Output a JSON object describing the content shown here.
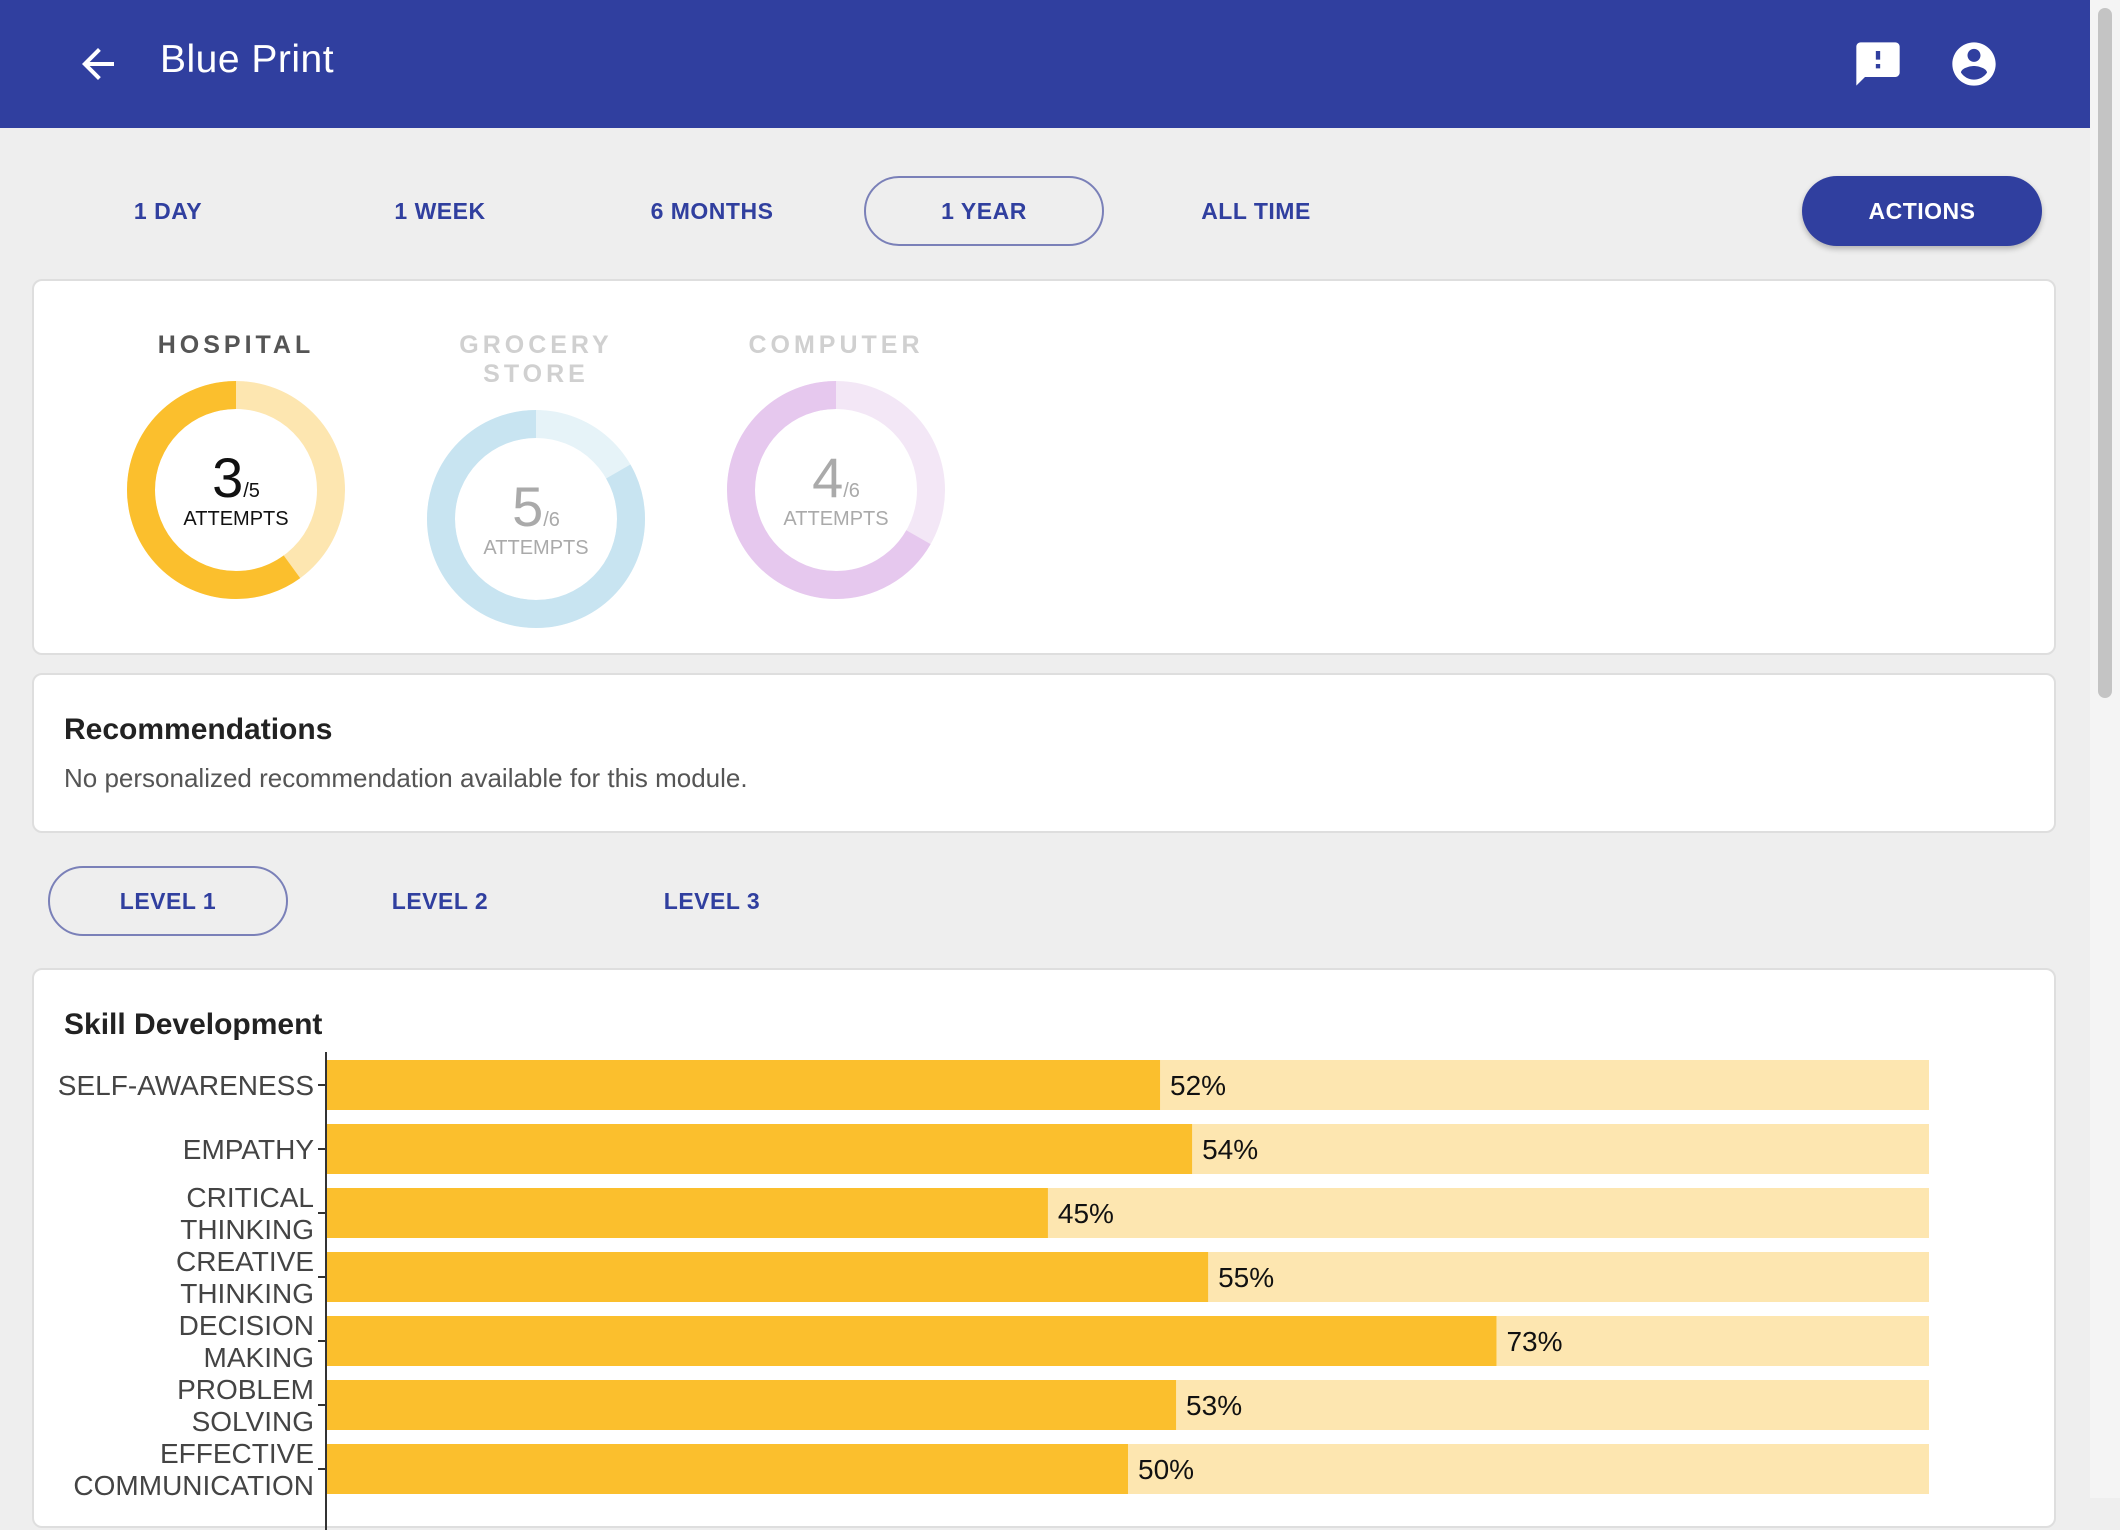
{
  "appbar": {
    "title": "Blue Print",
    "back_icon": "arrow-back-icon",
    "feedback_icon": "feedback-icon",
    "account_icon": "account-circle-icon",
    "color": "#303f9f"
  },
  "time_tabs": {
    "items": [
      "1 DAY",
      "1 WEEK",
      "6 MONTHS",
      "1 YEAR",
      "ALL TIME"
    ],
    "selected": "1 YEAR"
  },
  "actions_label": "ACTIONS",
  "modules": [
    {
      "name": "HOSPITAL",
      "attempts": "3",
      "total": "/5",
      "label": "ATTEMPTS",
      "progress": 0.6,
      "active": true,
      "color": "#fbbf2d",
      "track": "#fde6b0"
    },
    {
      "name": "GROCERY STORE",
      "attempts": "5",
      "total": "/6",
      "label": "ATTEMPTS",
      "progress": 0.833,
      "active": false,
      "color": "#c8e4f1",
      "track": "#e6f3f8"
    },
    {
      "name": "COMPUTER",
      "attempts": "4",
      "total": "/6",
      "label": "ATTEMPTS",
      "progress": 0.667,
      "active": false,
      "color": "#e6c8ee",
      "track": "#f3e7f6"
    }
  ],
  "recommendations": {
    "title": "Recommendations",
    "text": "No personalized recommendation available for this module."
  },
  "level_tabs": {
    "items": [
      "LEVEL 1",
      "LEVEL 2",
      "LEVEL 3"
    ],
    "selected": "LEVEL 1"
  },
  "skill_title": "Skill Development",
  "chart_data": {
    "type": "bar",
    "orientation": "horizontal",
    "categories": [
      [
        "SELF-AWARENESS"
      ],
      [
        "EMPATHY"
      ],
      [
        "CRITICAL",
        "THINKING"
      ],
      [
        "CREATIVE",
        "THINKING"
      ],
      [
        "DECISION",
        "MAKING"
      ],
      [
        "PROBLEM",
        "SOLVING"
      ],
      [
        "EFFECTIVE",
        "COMMUNICATION"
      ]
    ],
    "values": [
      52,
      54,
      45,
      55,
      73,
      53,
      50
    ],
    "value_labels": [
      "52%",
      "54%",
      "45%",
      "55%",
      "73%",
      "53%",
      "50%"
    ],
    "xlim": [
      0,
      100
    ],
    "bar_color": "#fbbf2d",
    "track_color": "#fde6b0"
  }
}
